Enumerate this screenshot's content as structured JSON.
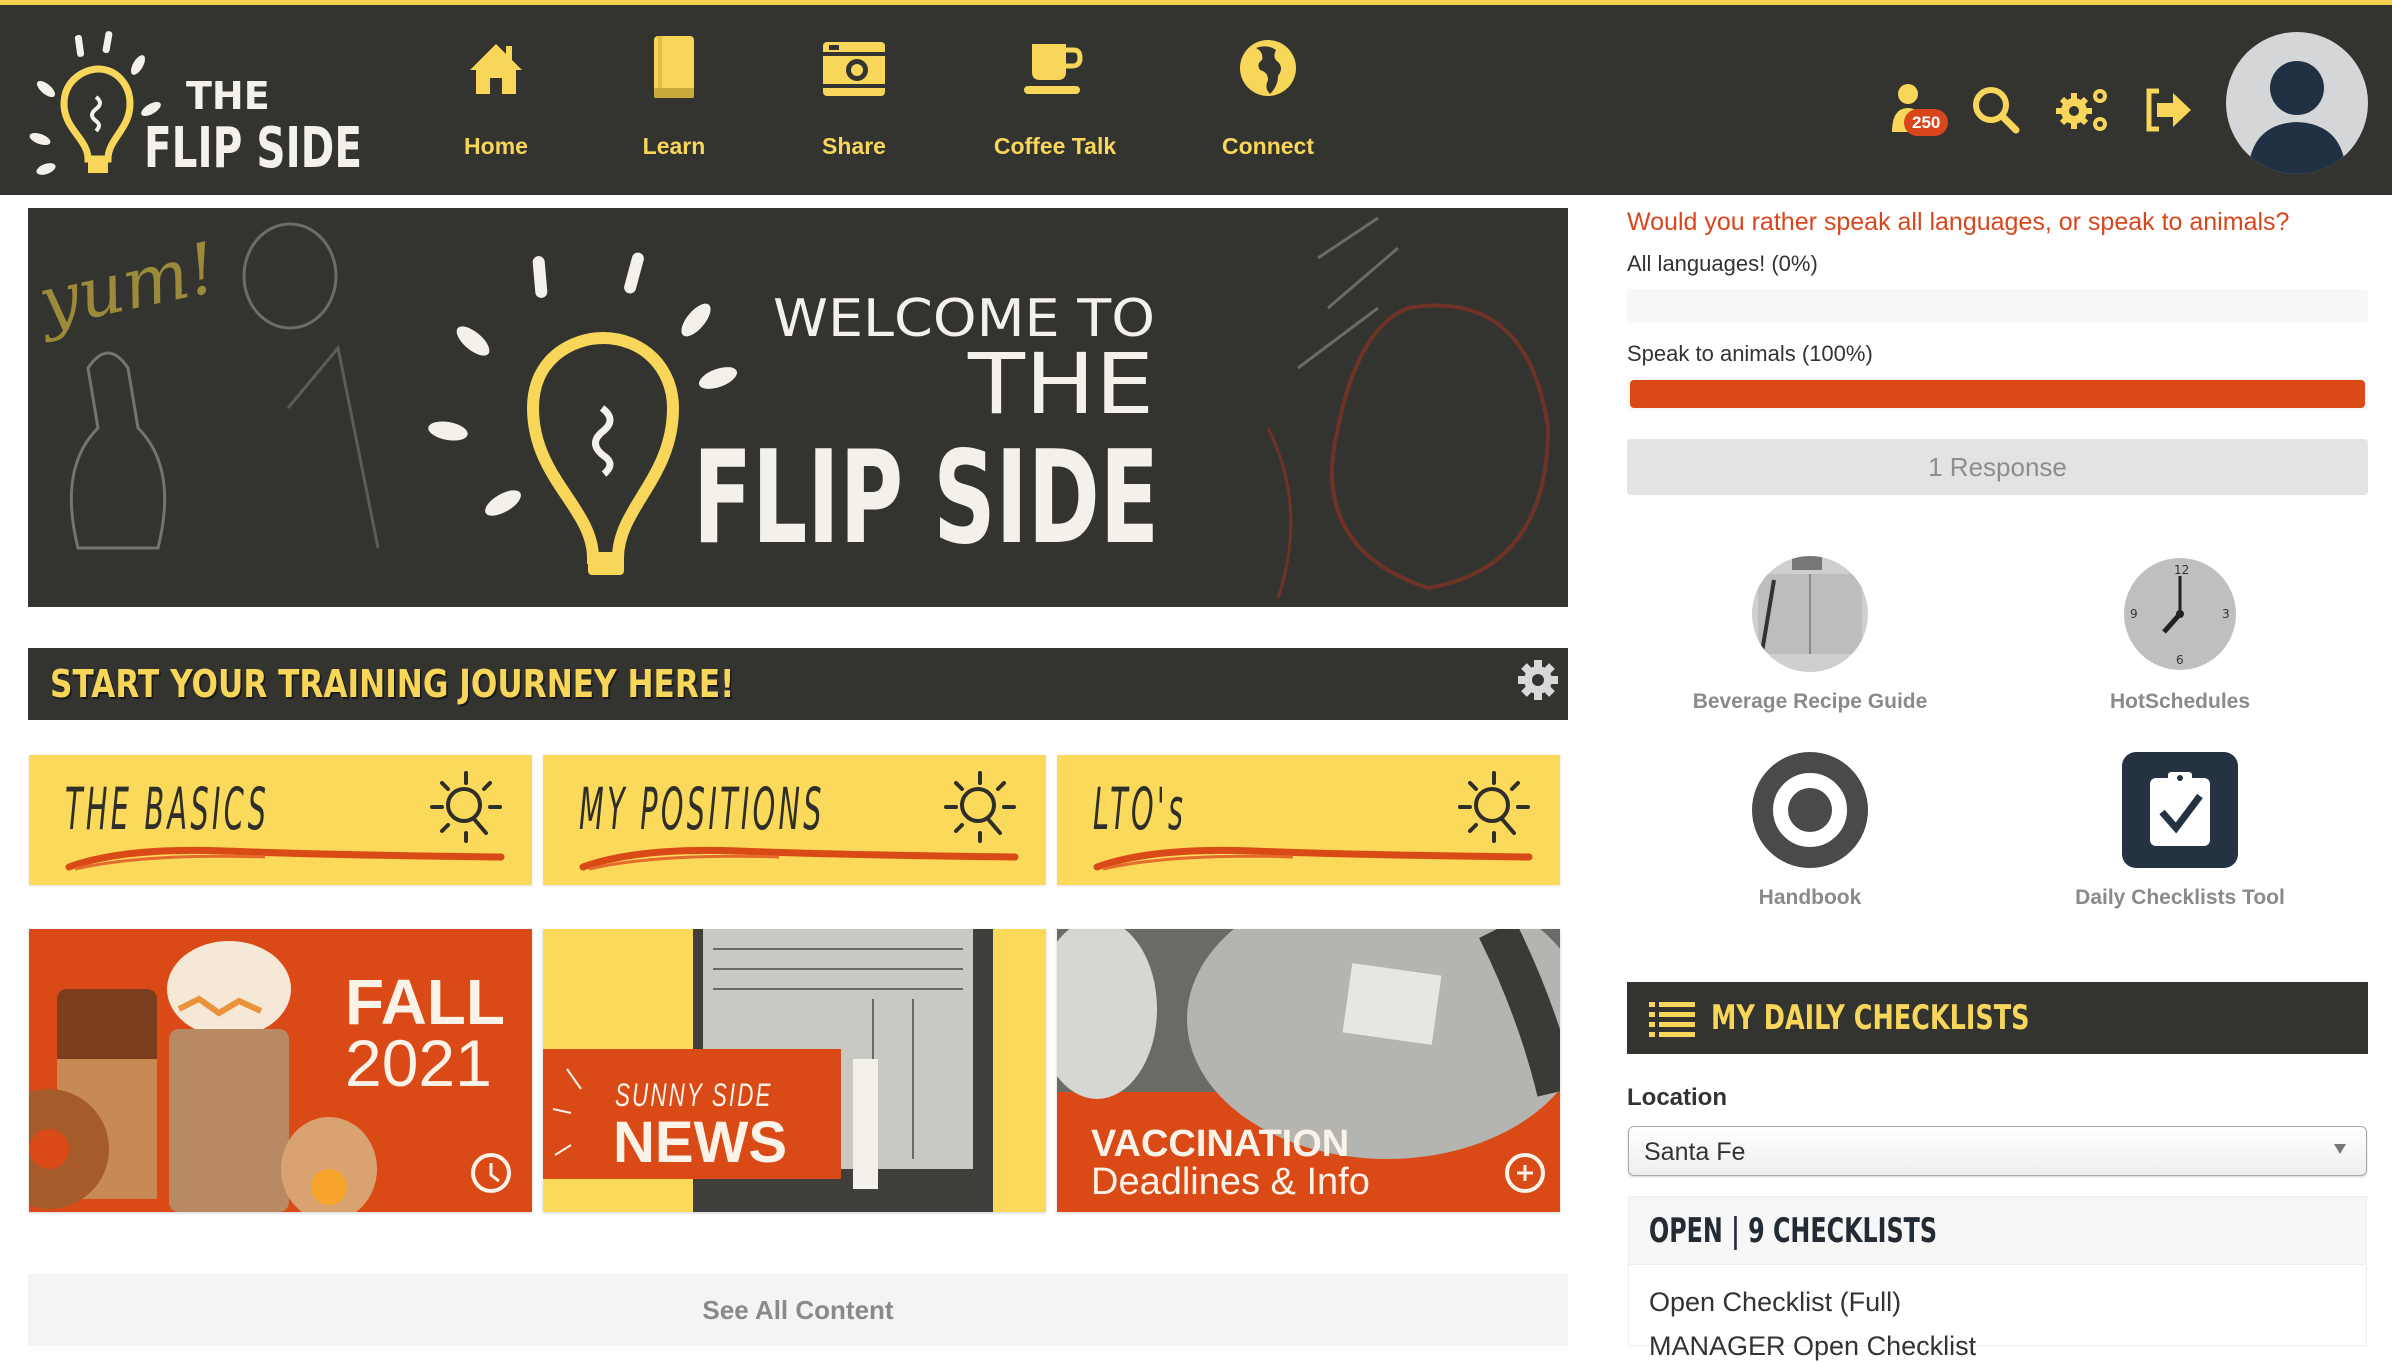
{
  "brand": {
    "logo_top": "THE",
    "logo_bottom": "FLIP SIDE",
    "accent_color": "#f7d65a",
    "nav_bg": "#333330",
    "orange": "#da4a17"
  },
  "nav": {
    "items": [
      {
        "label": "Home",
        "icon": "home-icon"
      },
      {
        "label": "Learn",
        "icon": "book-icon"
      },
      {
        "label": "Share",
        "icon": "camera-icon"
      },
      {
        "label": "Coffee Talk",
        "icon": "coffee-cup-icon"
      },
      {
        "label": "Connect",
        "icon": "globe-icon"
      }
    ],
    "notifications_count": "250",
    "right_icons": [
      "user-notification-icon",
      "search-icon",
      "settings-gears-icon",
      "logout-icon",
      "avatar"
    ]
  },
  "hero": {
    "line1": "WELCOME TO",
    "line2": "THE",
    "line3": "FLIP SIDE",
    "script_word": "yum!"
  },
  "training": {
    "title": "START YOUR TRAINING JOURNEY HERE!",
    "tiles": [
      {
        "label": "THE BASICS"
      },
      {
        "label": "MY POSITIONS"
      },
      {
        "label": "LTO's"
      }
    ]
  },
  "cards": [
    {
      "title": "FALL",
      "subtitle": "2021"
    },
    {
      "title": "NEWS",
      "subtitle": "SUNNY SIDE"
    },
    {
      "title": "VACCINATION",
      "subtitle": "Deadlines & Info"
    }
  ],
  "see_all": "See All Content",
  "poll": {
    "question": "Would you rather speak all languages, or speak to animals?",
    "options": [
      {
        "label": "All languages! (0%)",
        "percent": 0
      },
      {
        "label": "Speak to animals (100%)",
        "percent": 100
      }
    ],
    "responses": "1 Response"
  },
  "quick_links": [
    {
      "label": "Beverage Recipe Guide"
    },
    {
      "label": "HotSchedules"
    },
    {
      "label": "Handbook"
    },
    {
      "label": "Daily Checklists Tool"
    }
  ],
  "checklists": {
    "title": "MY DAILY CHECKLISTS",
    "location_label": "Location",
    "location_value": "Santa Fe",
    "panel_header": "OPEN | 9 CHECKLISTS",
    "items": [
      "Open Checklist (Full)",
      "MANAGER Open Checklist"
    ]
  }
}
